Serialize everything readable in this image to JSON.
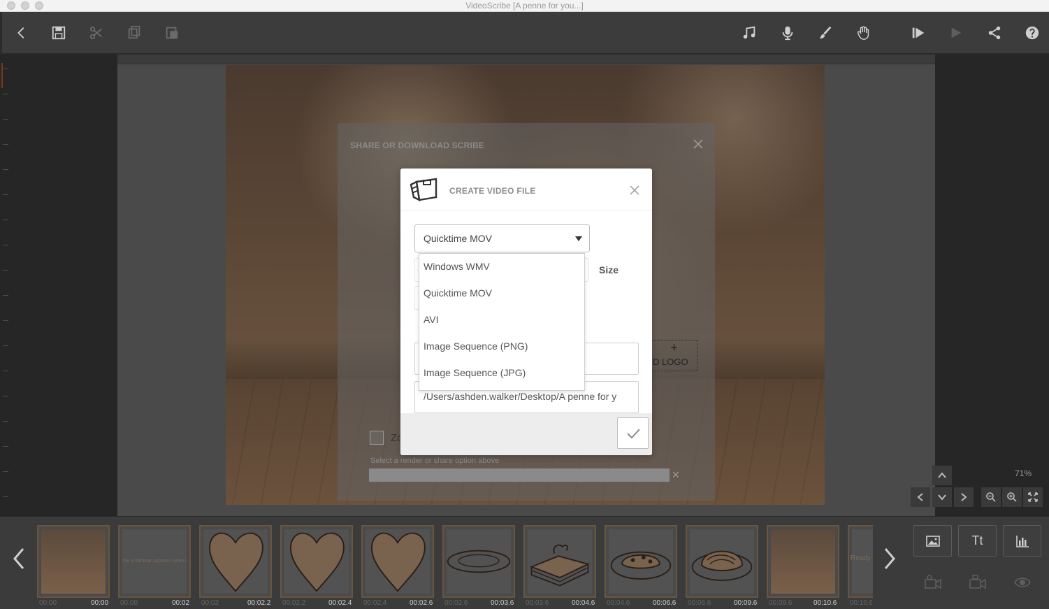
{
  "window": {
    "title": "VideoScribe [A penne for you...]"
  },
  "share_dialog": {
    "title": "SHARE OR DOWNLOAD SCRIBE",
    "checkbox_label_partial": "Zo",
    "hint": "Select a render or share option above",
    "logo_plus": "+",
    "logo_label": "D LOGO"
  },
  "create_video_dialog": {
    "title": "CREATE VIDEO FILE",
    "format_selected": "Quicktime MOV",
    "size_label": "Size",
    "path_value": "/Users/ashden.walker/Desktop/A penne for y",
    "format_options": [
      "Windows WMV",
      "Quicktime MOV",
      "AVI",
      "Image Sequence (PNG)",
      "Image Sequence (JPG)"
    ]
  },
  "zoom": {
    "level": "71%"
  },
  "filmstrip": {
    "thumbs": [
      {
        "kind": "photo",
        "start": "00:00",
        "end": "00:00"
      },
      {
        "kind": "text",
        "start": "00:00",
        "end": "00:02"
      },
      {
        "kind": "heart",
        "start": "00:02",
        "end": "00:02.2"
      },
      {
        "kind": "heart",
        "start": "00:02.2",
        "end": "00:02.4"
      },
      {
        "kind": "heart",
        "start": "00:02.4",
        "end": "00:02.6"
      },
      {
        "kind": "plate",
        "start": "00:02.6",
        "end": "00:03.6"
      },
      {
        "kind": "lasagna",
        "start": "00:03.6",
        "end": "00:04.6"
      },
      {
        "kind": "pasta",
        "start": "00:04.6",
        "end": "00:06.6"
      },
      {
        "kind": "spaghetti",
        "start": "00:06.6",
        "end": "00:09.6"
      },
      {
        "kind": "photo",
        "start": "00:09.6",
        "end": "00:10.6"
      },
      {
        "kind": "ready",
        "start": "00:10.6",
        "end": ""
      }
    ],
    "ready_label": "Ready",
    "text_thumb_label": "the unfamiliar appears when I"
  },
  "side_buttons": {
    "text_label": "Tt"
  },
  "icons": {
    "toolbar": [
      "back-icon",
      "save-icon",
      "cut-icon",
      "copy-icon",
      "paste-icon",
      "music-icon",
      "microphone-icon",
      "brush-icon",
      "hand-icon",
      "play-from-icon",
      "play-icon",
      "share-icon",
      "help-icon"
    ]
  }
}
